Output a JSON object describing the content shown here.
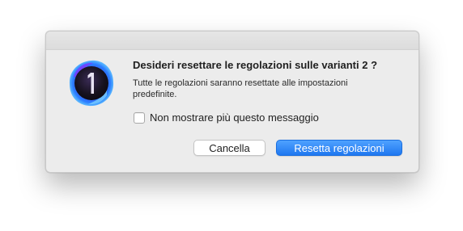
{
  "dialog": {
    "app_icon": "capture-one-app-icon",
    "title": "Desideri resettare le regolazioni sulle varianti 2 ?",
    "message": "Tutte le regolazioni saranno resettate alle impostazioni predefinite.",
    "checkbox": {
      "label": "Non mostrare più questo messaggio",
      "checked": false
    },
    "buttons": {
      "cancel_label": "Cancella",
      "confirm_label": "Resetta regolazioni"
    },
    "accent_color": "#2a82f6"
  }
}
